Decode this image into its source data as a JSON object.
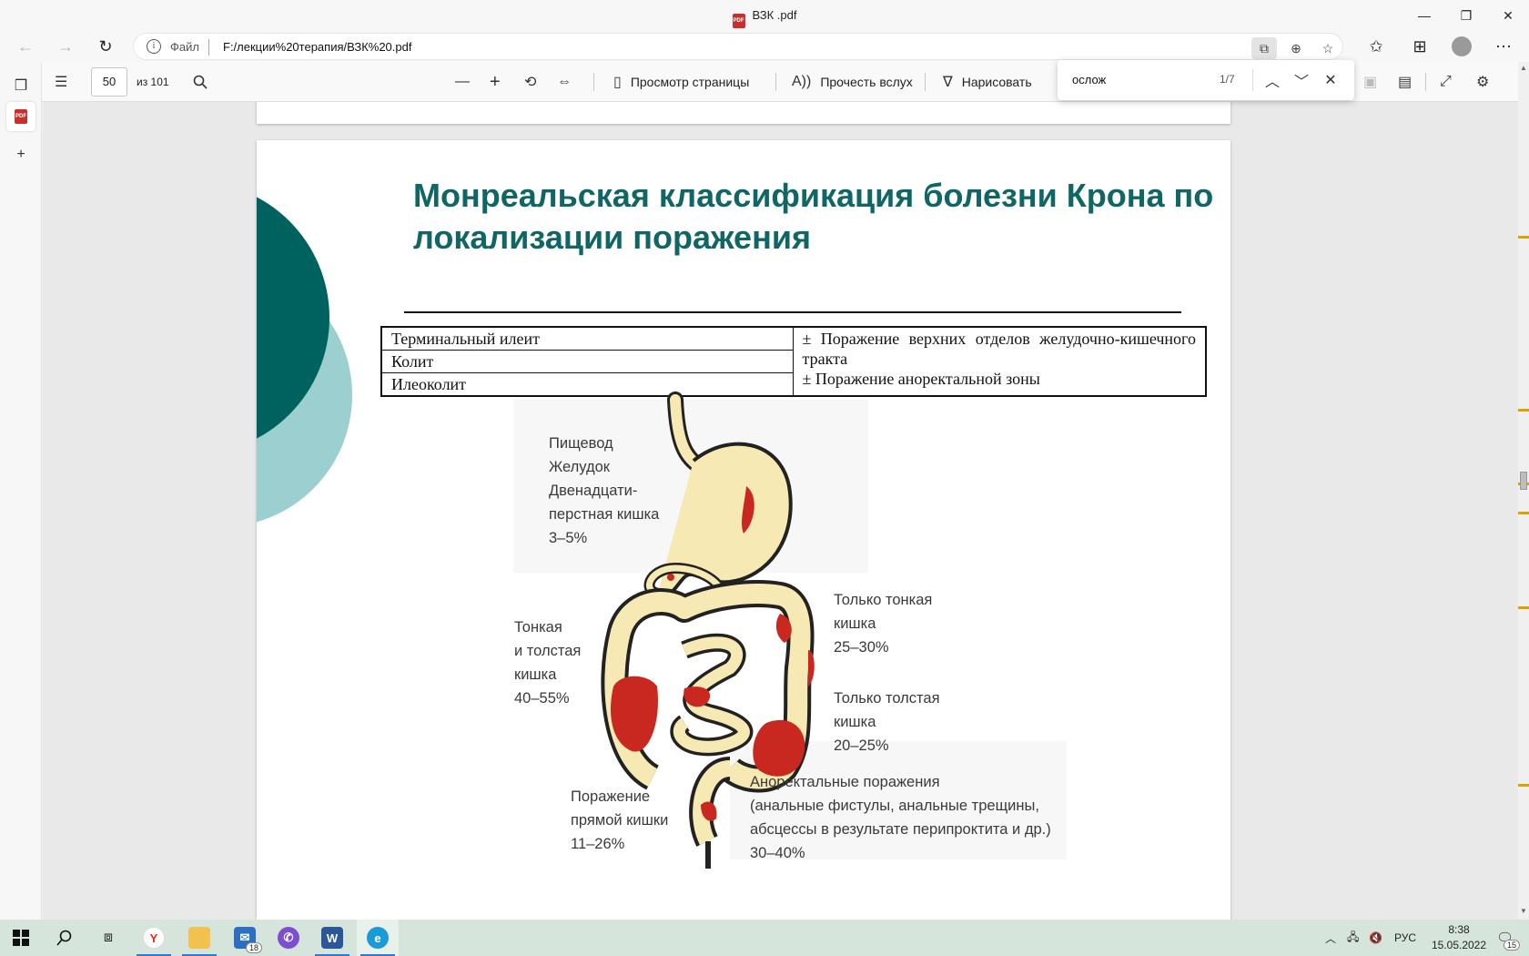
{
  "window": {
    "title": "ВЗК .pdf",
    "minimize_glyph": "—",
    "restore_glyph": "❐",
    "close_glyph": "✕"
  },
  "browser": {
    "scheme_label": "Файл",
    "url": "F:/лекции%20терапия/ВЗК%20.pdf"
  },
  "pdf_toolbar": {
    "page_number": "50",
    "page_total": "из 101",
    "page_view_label": "Просмотр страницы",
    "read_aloud_label": "Прочесть вслух",
    "draw_label": "Нарисовать"
  },
  "find": {
    "query": "ослож",
    "count": "1/7"
  },
  "slide": {
    "title": "Монреальская классификация болезни Крона по локализации поражения",
    "table": {
      "left_rows": [
        "Терминальный илеит",
        "Колит",
        "Илеоколит"
      ],
      "right_line1": "± Поражение верхних отделов желудочно-кишечного тракта",
      "right_line2": "± Поражение аноректальной зоны"
    },
    "labels": {
      "upper": "Пищевод\nЖелудок\nДвенадцати-\nперстная кишка\n3–5%",
      "small_large": "Тонкая\nи толстая\nкишка\n40–55%",
      "small_only": "Только тонкая\nкишка\n25–30%",
      "large_only": "Только толстая\nкишка\n20–25%",
      "anorectal": "Аноректальные поражения\n(анальные фистулы, анальные трещины,\nабсцессы в результате перипроктита и др.)\n30–40%",
      "rectal": "Поражение\nпрямой кишки\n11–26%"
    }
  },
  "taskbar": {
    "mail_badge": "18",
    "language": "РУС",
    "time": "8:38",
    "date": "15.05.2022",
    "notifications": "15"
  },
  "colors": {
    "title_teal": "#0f6664",
    "dark_teal": "#00625f",
    "light_teal": "#9ccfcf",
    "organ_fill": "#f6e9b3",
    "lesion_red": "#c8281f",
    "taskbar": "#d6e5db"
  }
}
